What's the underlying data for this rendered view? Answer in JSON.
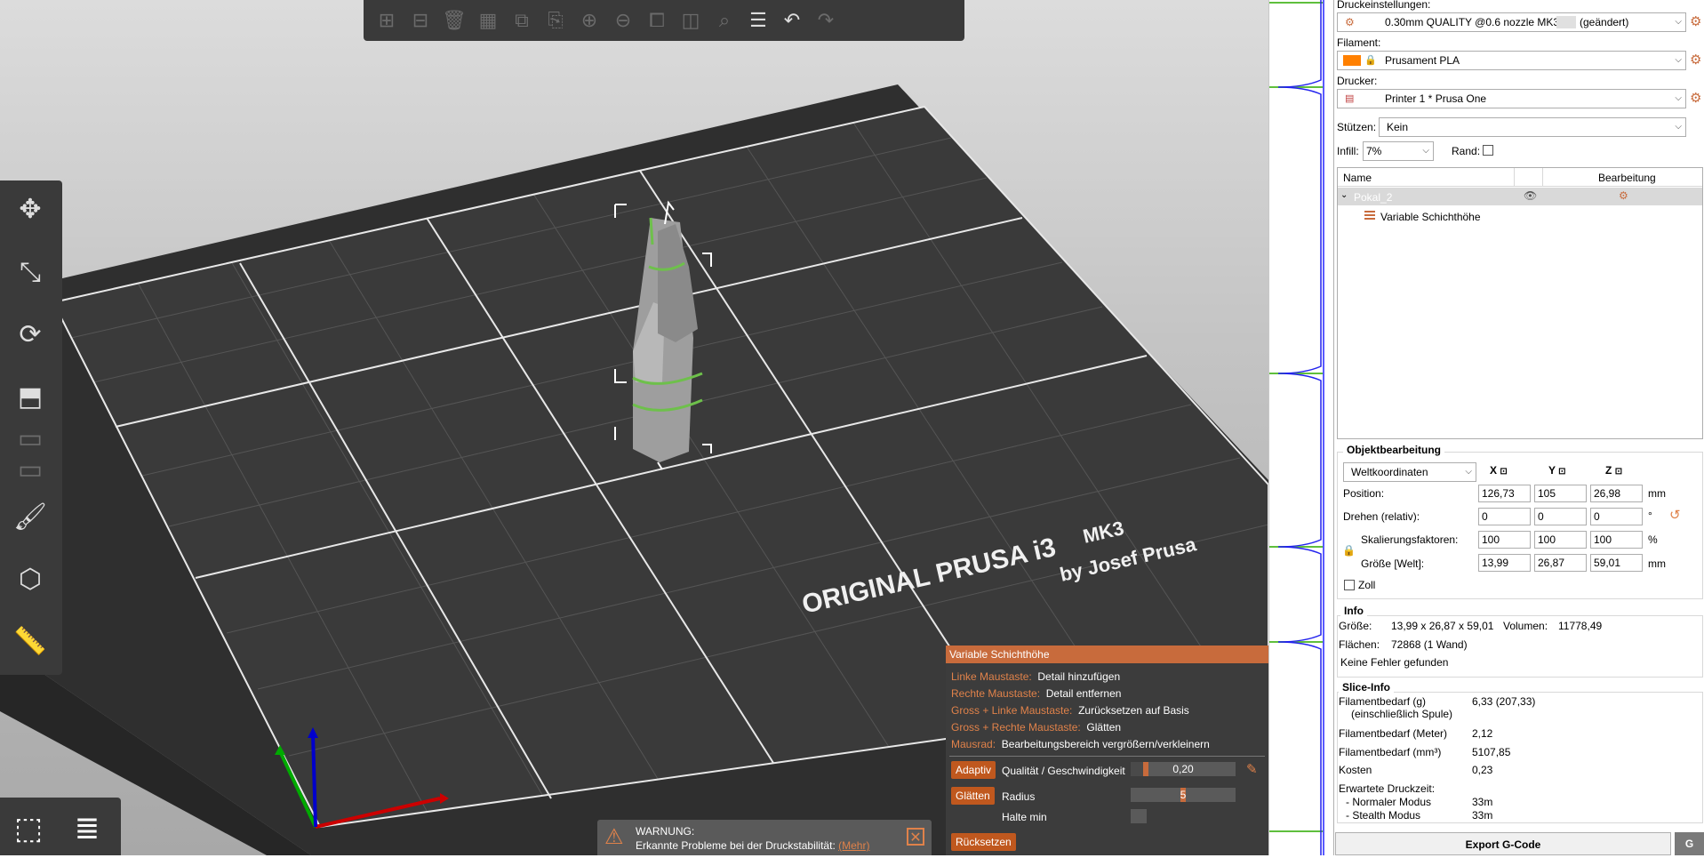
{
  "toolbar": {
    "icons": [
      "add-icon",
      "delete-icon",
      "delete-all-icon",
      "arrange-icon",
      "copy-icon",
      "paste-icon",
      "add-instance-icon",
      "remove-instance-icon",
      "split-objects-icon",
      "split-parts-icon",
      "search-icon",
      "layers-editing-icon",
      "undo-icon",
      "redo-icon"
    ]
  },
  "viewport": {
    "bed_brand": "ORIGINAL PRUSA i3",
    "bed_model": "MK3",
    "bed_maker": "by Josef Prusa"
  },
  "vlh": {
    "title": "Variable Schichthöhe",
    "rows": [
      {
        "key": "Linke Maustaste:",
        "val": "Detail hinzufügen"
      },
      {
        "key": "Rechte Maustaste:",
        "val": "Detail entfernen"
      },
      {
        "key": "Gross + Linke Maustaste:",
        "val": "Zurücksetzen auf Basis"
      },
      {
        "key": "Gross + Rechte Maustaste:",
        "val": "Glätten"
      },
      {
        "key": "Mausrad:",
        "val": "Bearbeitungsbereich vergrößern/verkleinern"
      }
    ],
    "adaptive_button": "Adaptiv",
    "quality_label": "Qualität / Geschwindigkeit",
    "quality_value": "0,20",
    "quality_level": 0.1,
    "smooth_button": "Glätten",
    "radius_label": "Radius",
    "radius_value": "5",
    "radius_level": 0.5,
    "keep_min_label": "Halte min",
    "reset_button": "Rücksetzen"
  },
  "warning": {
    "title": "WARNUNG:",
    "text": "Erkannte Probleme bei der Druckstabilität:",
    "link": "(Mehr)"
  },
  "panel": {
    "print_settings_label": "Druckeinstellungen:",
    "print_settings_value": "0.30mm QUALITY @0.6 nozzle MK3",
    "print_settings_modified": "(geändert)",
    "filament_label": "Filament:",
    "filament_value": "Prusament PLA",
    "filament_color": "#ff8000",
    "printer_label": "Drucker:",
    "printer_value": "Printer 1 * Prusa One",
    "supports_label": "Stützen:",
    "supports_value": "Kein",
    "infill_label": "Infill:",
    "infill_value": "7%",
    "brim_label": "Rand:",
    "list_col_name": "Name",
    "list_col_edit": "Bearbeitung",
    "object_name": "Pokal_2",
    "object_child": "Variable Schichthöhe"
  },
  "manip": {
    "title": "Objektbearbeitung",
    "coord_system": "Weltkoordinaten",
    "axis_x": "X",
    "axis_y": "Y",
    "axis_z": "Z",
    "position_label": "Position:",
    "position": [
      "126,73",
      "105",
      "26,98"
    ],
    "position_unit": "mm",
    "rotate_label": "Drehen (relativ):",
    "rotate": [
      "0",
      "0",
      "0"
    ],
    "rotate_unit": "°",
    "scale_label": "Skalierungsfaktoren:",
    "scale": [
      "100",
      "100",
      "100"
    ],
    "scale_unit": "%",
    "size_label": "Größe [Welt]:",
    "size": [
      "13,99",
      "26,87",
      "59,01"
    ],
    "size_unit": "mm",
    "inch_label": "Zoll"
  },
  "info": {
    "title": "Info",
    "size_label": "Größe:",
    "size_value": "13,99 x 26,87 x 59,01",
    "volume_label": "Volumen:",
    "volume_value": "11778,49",
    "facets_label": "Flächen:",
    "facets_value": "72868 (1 Wand)",
    "errors": "Keine Fehler gefunden"
  },
  "slice": {
    "title": "Slice-Info",
    "fil_g_label": "Filamentbedarf (g)",
    "fil_g_sub": "(einschließlich Spule)",
    "fil_g_value": "6,33 (207,33)",
    "fil_m_label": "Filamentbedarf (Meter)",
    "fil_m_value": "2,12",
    "fil_mm3_label": "Filamentbedarf (mm³)",
    "fil_mm3_value": "5107,85",
    "cost_label": "Kosten",
    "cost_value": "0,23",
    "time_label": "Erwartete Druckzeit:",
    "normal_label": "- Normaler Modus",
    "normal_value": "33m",
    "stealth_label": "- Stealth Modus",
    "stealth_value": "33m"
  },
  "export_button": "Export G-Code"
}
